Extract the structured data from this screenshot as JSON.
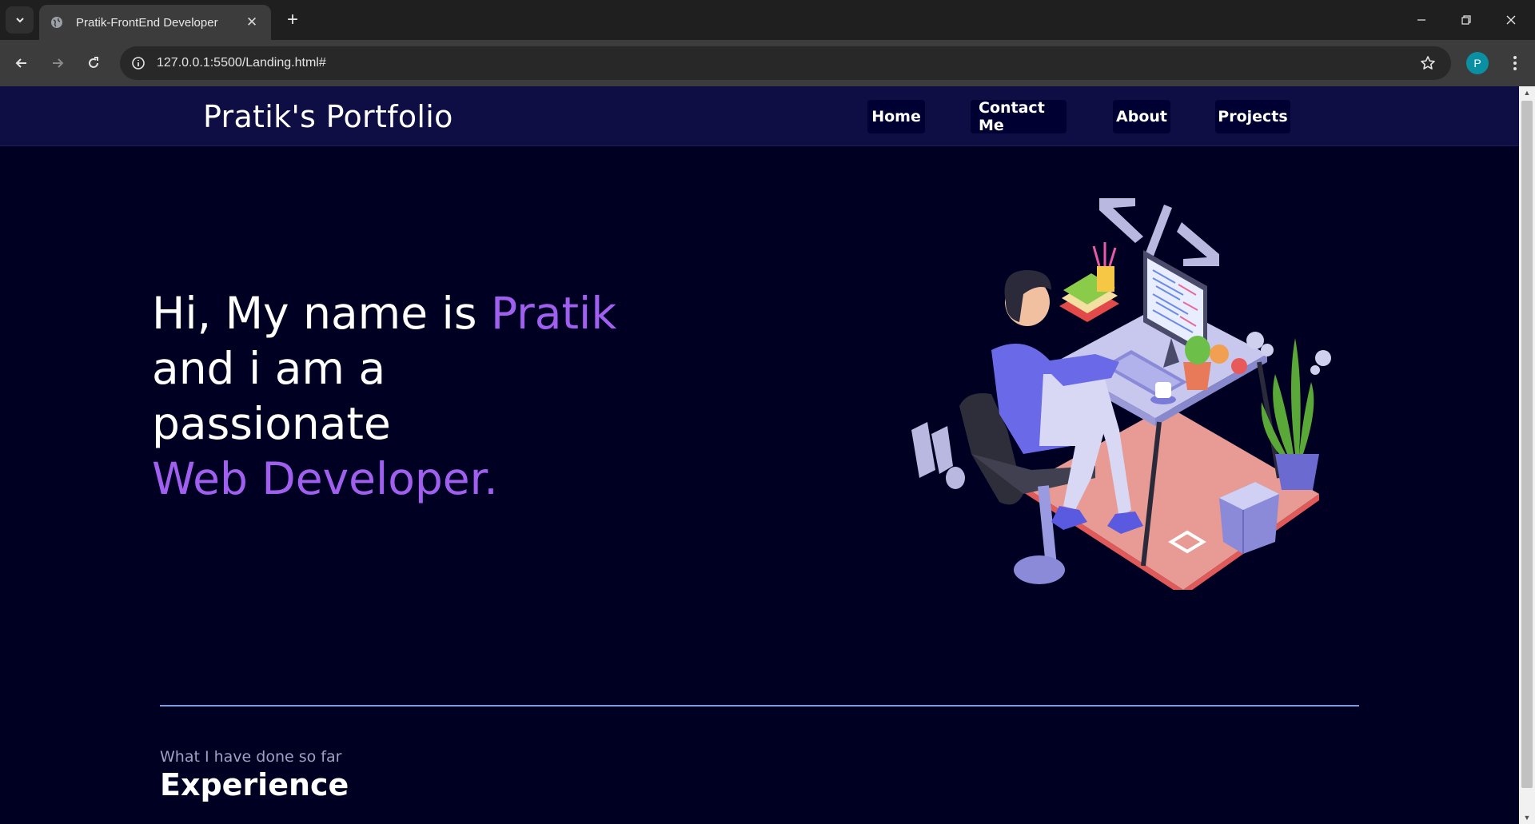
{
  "browser": {
    "tab_title": "Pratik-FrontEnd Developer",
    "url": "127.0.0.1:5500/Landing.html#",
    "profile_initial": "P"
  },
  "navbar": {
    "brand": "Pratik's Portfolio",
    "links": [
      "Home",
      "Contact Me",
      "About",
      "Projects"
    ]
  },
  "hero": {
    "line1_prefix": "Hi, My name is ",
    "name": "Pratik",
    "line2": "and i am a",
    "line3": "passionate",
    "role": "Web Developer."
  },
  "experience": {
    "subtitle": "What I have done so far",
    "title": "Experience"
  },
  "colors": {
    "page_bg": "#000022",
    "navbar_bg": "#0e0e44",
    "accent": "#a15ff0",
    "divider": "#7a9cdf"
  }
}
